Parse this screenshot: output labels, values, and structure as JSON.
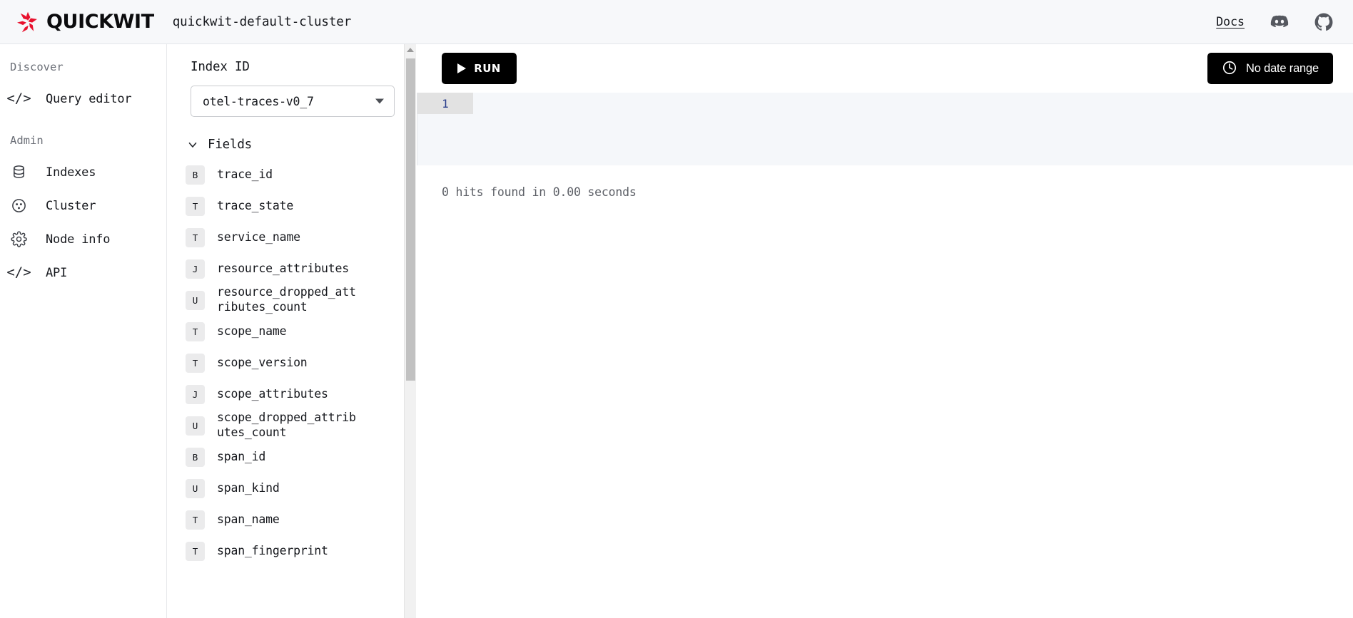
{
  "header": {
    "brand_name": "QUICKWIT",
    "logo_icon": "quickwit-pinwheel-logo",
    "cluster_name": "quickwit-default-cluster",
    "docs_label": "Docs",
    "discord_icon": "discord-icon",
    "github_icon": "github-icon"
  },
  "sidebar": {
    "sections": [
      {
        "label": "Discover",
        "items": [
          {
            "label": "Query editor",
            "icon": "code-brackets-icon"
          }
        ]
      },
      {
        "label": "Admin",
        "items": [
          {
            "label": "Indexes",
            "icon": "database-icon"
          },
          {
            "label": "Cluster",
            "icon": "cluster-nodes-icon"
          },
          {
            "label": "Node info",
            "icon": "gear-icon"
          },
          {
            "label": "API",
            "icon": "code-brackets-icon"
          }
        ]
      }
    ]
  },
  "fields_panel": {
    "index_id_label": "Index ID",
    "selected_index": "otel-traces-v0_7",
    "dropdown_icon": "chevron-down-icon",
    "fields_label": "Fields",
    "fields_collapse_icon": "chevron-down-icon",
    "fields": [
      {
        "type": "B",
        "name": "trace_id"
      },
      {
        "type": "T",
        "name": "trace_state"
      },
      {
        "type": "T",
        "name": "service_name"
      },
      {
        "type": "J",
        "name": "resource_attributes"
      },
      {
        "type": "U",
        "name": "resource_dropped_attributes_count"
      },
      {
        "type": "T",
        "name": "scope_name"
      },
      {
        "type": "T",
        "name": "scope_version"
      },
      {
        "type": "J",
        "name": "scope_attributes"
      },
      {
        "type": "U",
        "name": "scope_dropped_attributes_count"
      },
      {
        "type": "B",
        "name": "span_id"
      },
      {
        "type": "U",
        "name": "span_kind"
      },
      {
        "type": "T",
        "name": "span_name"
      },
      {
        "type": "T",
        "name": "span_fingerprint"
      }
    ]
  },
  "main": {
    "run_label": "RUN",
    "run_icon": "play-triangle-icon",
    "date_range_label": "No date range",
    "date_range_icon": "clock-icon",
    "editor_line_number": "1",
    "editor_query": "",
    "hits_status": "0 hits found in 0.00 seconds"
  },
  "colors": {
    "accent_red": "#e8112d",
    "button_black": "#000000",
    "header_bg": "#f7f8fa",
    "editor_bg": "#f5f7fa",
    "line_number_text": "#2b3f8c"
  }
}
